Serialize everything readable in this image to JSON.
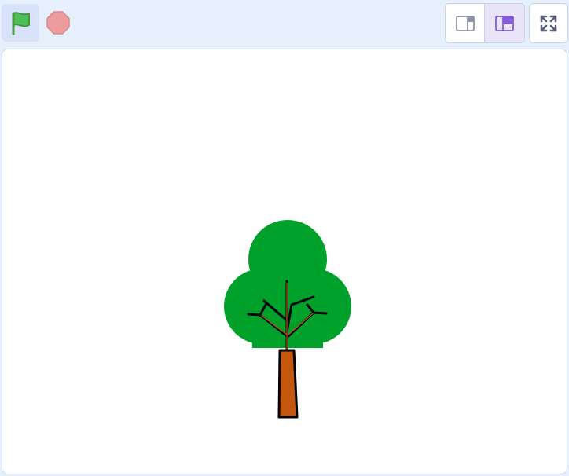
{
  "toolbar": {
    "controls": [
      {
        "name": "green-flag",
        "icon": "green-flag-icon",
        "color": "#4cbf56"
      },
      {
        "name": "stop",
        "icon": "stop-sign-icon",
        "color": "#ec9c9c"
      }
    ],
    "layout_modes": [
      {
        "name": "small-stage",
        "icon": "small-stage-icon",
        "selected": false
      },
      {
        "name": "normal-stage",
        "icon": "normal-stage-icon",
        "selected": true,
        "accent": "#855cd6"
      }
    ],
    "fullscreen": {
      "icon": "fullscreen-icon",
      "color": "#575e75"
    }
  },
  "stage": {
    "background": "#ffffff",
    "sprites": [
      {
        "name": "tree",
        "icon": "tree-icon",
        "foliage_color": "#00a12b",
        "trunk_color": "#c4570c"
      }
    ]
  }
}
